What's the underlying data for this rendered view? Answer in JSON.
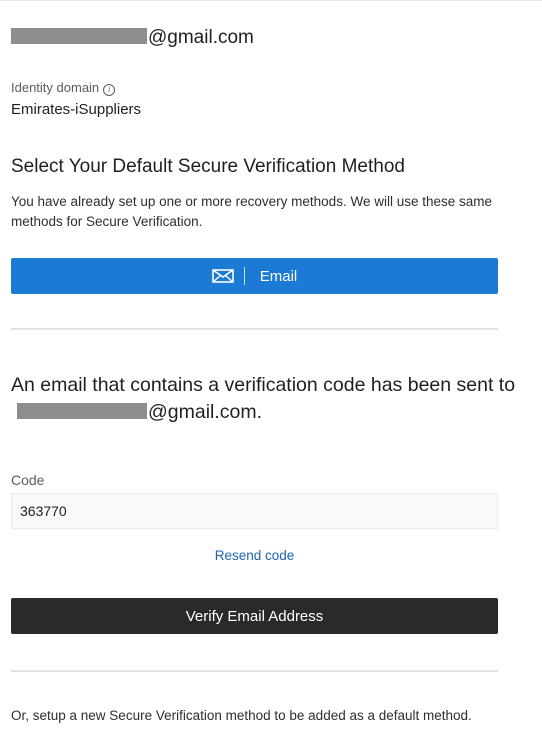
{
  "account": {
    "email_suffix": "@gmail.com"
  },
  "identity_domain": {
    "label": "Identity domain",
    "info_icon_glyph": "i",
    "value": "Emirates-iSuppliers"
  },
  "method_section": {
    "title": "Select Your Default Secure Verification Method",
    "description": "You have already set up one or more recovery methods. We will use these same methods for Secure Verification.",
    "email_button_label": "Email",
    "email_button_icon": "envelope-icon",
    "accent_color": "#1a7ad4"
  },
  "verification": {
    "message_prefix": "An email that contains a verification code has been sent to",
    "message_suffix": "@gmail.com.",
    "code_label": "Code",
    "code_value": "363770",
    "resend_label": "Resend code",
    "verify_button_label": "Verify Email Address"
  },
  "footer": {
    "text": "Or, setup a new Secure Verification method to be added as a default method."
  }
}
